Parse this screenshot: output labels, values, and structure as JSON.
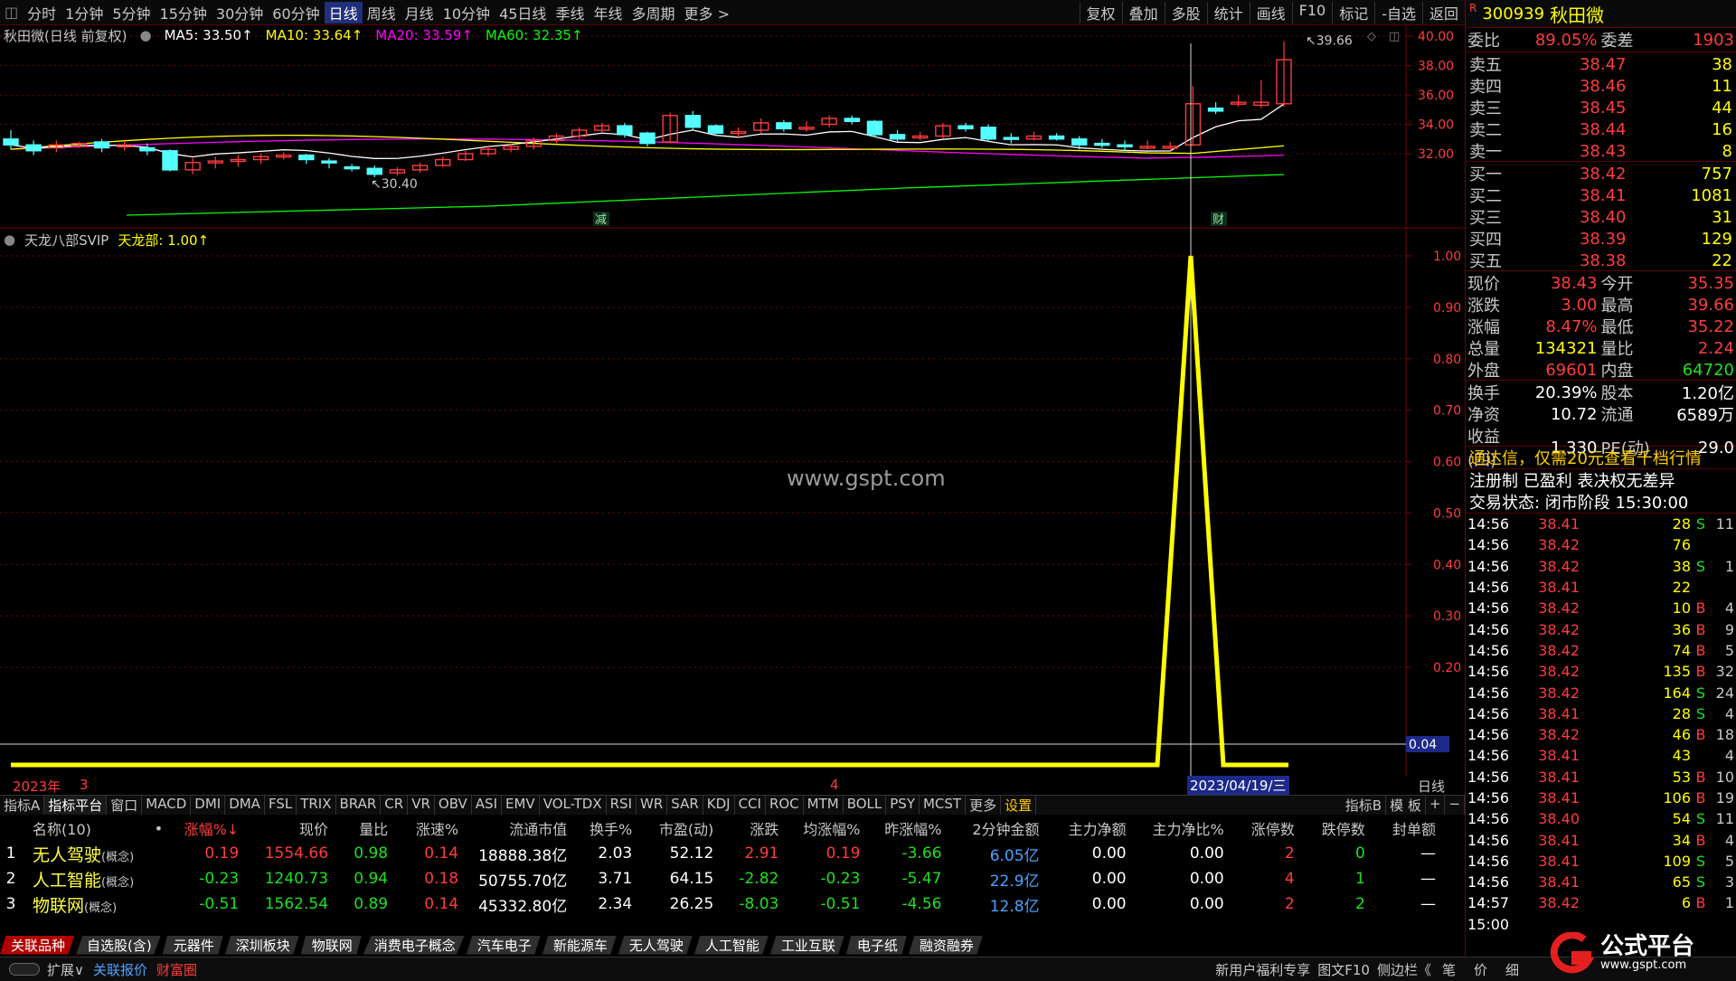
{
  "toolbar": {
    "periods": [
      "分时",
      "1分钟",
      "5分钟",
      "15分钟",
      "30分钟",
      "60分钟",
      "日线",
      "周线",
      "月线",
      "10分钟",
      "45日线",
      "季线",
      "年线",
      "多周期",
      "更多 >"
    ],
    "active_period": "日线",
    "tools": [
      "复权",
      "叠加",
      "多股",
      "统计",
      "画线",
      "F10",
      "标记",
      "-自选",
      "返回"
    ]
  },
  "chart": {
    "title": "秋田微(日线 前复权)",
    "ma5": "MA5: 33.50↑",
    "ma10": "MA10: 33.64↑",
    "ma20": "MA20: 33.59↑",
    "ma60": "MA60: 32.35↑",
    "high_label": "39.66",
    "low_label": "30.40",
    "marker_jian": "减",
    "marker_cai": "财",
    "price_axis": [
      "40.00",
      "38.00",
      "36.00",
      "34.00",
      "32.00"
    ],
    "indicator_title": "天龙八部SVIP",
    "indicator_value": "天龙部: 1.00↑",
    "indicator_axis": [
      "1.00",
      "0.90",
      "0.80",
      "0.70",
      "0.60",
      "0.50",
      "0.40",
      "0.30",
      "0.20"
    ],
    "indicator_cursor_value": "0.04",
    "date_year": "2023年",
    "date_m3": "3",
    "date_m4": "4",
    "cursor_date": "2023/04/19/三",
    "period_label": "日线",
    "watermark": "www.gspt.com"
  },
  "indicator_tabs": [
    "指标A",
    "指标平台",
    "窗口",
    "MACD",
    "DMI",
    "DMA",
    "FSL",
    "TRIX",
    "BRAR",
    "CR",
    "VR",
    "OBV",
    "ASI",
    "EMV",
    "VOL-TDX",
    "RSI",
    "WR",
    "SAR",
    "KDJ",
    "CCI",
    "ROC",
    "MTM",
    "BOLL",
    "PSY",
    "MCST",
    "更多",
    "设置"
  ],
  "indicator_tabs_right": [
    "指标B",
    "模 板",
    "+",
    "−"
  ],
  "sector_table": {
    "headers": [
      "名称(10)",
      "•",
      "涨幅%↓",
      "现价",
      "量比",
      "涨速%",
      "流通市值",
      "换手%",
      "市盈(动)",
      "涨跌",
      "均涨幅%",
      "昨涨幅%",
      "2分钟金额",
      "主力净额",
      "主力净比%",
      "涨停数",
      "跌停数",
      "封单额"
    ],
    "rows": [
      {
        "idx": "1",
        "name": "无人驾驶",
        "tag": "(概念)",
        "chg": "0.19",
        "price": "1554.66",
        "vr": "0.98",
        "spd": "0.14",
        "cap": "18888.38亿",
        "turn": "2.03",
        "pe": "52.12",
        "diff": "2.91",
        "avg": "0.19",
        "yday": "-3.66",
        "amt2": "6.05亿",
        "net": "0.00",
        "netp": "0.00",
        "up": "2",
        "down": "0",
        "seal": "—"
      },
      {
        "idx": "2",
        "name": "人工智能",
        "tag": "(概念)",
        "chg": "-0.23",
        "price": "1240.73",
        "vr": "0.94",
        "spd": "0.18",
        "cap": "50755.70亿",
        "turn": "3.71",
        "pe": "64.15",
        "diff": "-2.82",
        "avg": "-0.23",
        "yday": "-5.47",
        "amt2": "22.9亿",
        "net": "0.00",
        "netp": "0.00",
        "up": "4",
        "down": "1",
        "seal": "—"
      },
      {
        "idx": "3",
        "name": "物联网",
        "tag": "(概念)",
        "chg": "-0.51",
        "price": "1562.54",
        "vr": "0.89",
        "spd": "0.14",
        "cap": "45332.80亿",
        "turn": "2.34",
        "pe": "26.25",
        "diff": "-8.03",
        "avg": "-0.51",
        "yday": "-4.56",
        "amt2": "12.8亿",
        "net": "0.00",
        "netp": "0.00",
        "up": "2",
        "down": "2",
        "seal": "—"
      }
    ]
  },
  "bottom_tabs": [
    "关联品种",
    "自选股(含)",
    "元器件",
    "深圳板块",
    "物联网",
    "消费电子概念",
    "汽车电子",
    "新能源车",
    "无人驾驶",
    "人工智能",
    "工业互联",
    "电子纸",
    "融资融券"
  ],
  "status_bar": {
    "left": [
      "扩展∨",
      "关联报价",
      "财富圈"
    ],
    "right": [
      "新用户福利专享",
      "图文F10",
      "侧边栏《",
      "笔",
      "价",
      "细"
    ]
  },
  "quote": {
    "code": "300939",
    "name": "秋田微",
    "r_mark": "R",
    "weibi_label": "委比",
    "weibi": "89.05%",
    "weicha_label": "委差",
    "weicha": "1903",
    "asks": [
      [
        "卖五",
        "38.47",
        "38"
      ],
      [
        "卖四",
        "38.46",
        "11"
      ],
      [
        "卖三",
        "38.45",
        "44"
      ],
      [
        "卖二",
        "38.44",
        "16"
      ],
      [
        "卖一",
        "38.43",
        "8"
      ]
    ],
    "bids": [
      [
        "买一",
        "38.42",
        "757"
      ],
      [
        "买二",
        "38.41",
        "1081"
      ],
      [
        "买三",
        "38.40",
        "31"
      ],
      [
        "买四",
        "38.39",
        "129"
      ],
      [
        "买五",
        "38.38",
        "22"
      ]
    ],
    "stats1": [
      [
        "现价",
        "38.43",
        "今开",
        "35.35"
      ],
      [
        "涨跌",
        "3.00",
        "最高",
        "39.66"
      ],
      [
        "涨幅",
        "8.47%",
        "最低",
        "35.22"
      ],
      [
        "总量",
        "134321",
        "量比",
        "2.24"
      ],
      [
        "外盘",
        "69601",
        "内盘",
        "64720"
      ]
    ],
    "stats2": [
      [
        "换手",
        "20.39%",
        "股本",
        "1.20亿"
      ],
      [
        "净资",
        "10.72",
        "流通",
        "6589万"
      ],
      [
        "收益(四)",
        "1.330",
        "PE(动)",
        "29.0"
      ]
    ],
    "promo": "通达信，仅需20元查看千档行情",
    "regline": "注册制 已盈利 表决权无差异",
    "trade_state": "交易状态: 闭市阶段 15:30:00",
    "ticks": [
      [
        "14:56",
        "38.41",
        "28",
        "S",
        "11"
      ],
      [
        "14:56",
        "38.42",
        "76",
        "",
        ""
      ],
      [
        "14:56",
        "38.42",
        "38",
        "S",
        "1"
      ],
      [
        "14:56",
        "38.41",
        "22",
        "",
        ""
      ],
      [
        "14:56",
        "38.42",
        "10",
        "B",
        "4"
      ],
      [
        "14:56",
        "38.42",
        "36",
        "B",
        "9"
      ],
      [
        "14:56",
        "38.42",
        "74",
        "B",
        "5"
      ],
      [
        "14:56",
        "38.42",
        "135",
        "B",
        "32"
      ],
      [
        "14:56",
        "38.42",
        "164",
        "S",
        "24"
      ],
      [
        "14:56",
        "38.41",
        "28",
        "S",
        "4"
      ],
      [
        "14:56",
        "38.42",
        "46",
        "B",
        "18"
      ],
      [
        "14:56",
        "38.41",
        "43",
        "",
        "4"
      ],
      [
        "14:56",
        "38.41",
        "53",
        "B",
        "10"
      ],
      [
        "14:56",
        "38.41",
        "106",
        "B",
        "19"
      ],
      [
        "14:56",
        "38.40",
        "54",
        "S",
        "11"
      ],
      [
        "14:56",
        "38.41",
        "34",
        "B",
        "4"
      ],
      [
        "14:56",
        "38.41",
        "109",
        "S",
        "5"
      ],
      [
        "14:56",
        "38.41",
        "65",
        "S",
        "3"
      ],
      [
        "14:57",
        "38.42",
        "6",
        "B",
        "1"
      ],
      [
        "15:00",
        "",
        "",
        "",
        ""
      ]
    ]
  },
  "logo": {
    "text": "公式平台",
    "url": "www.gspt.com"
  },
  "colors": {
    "up": "#ff3c3c",
    "down": "#1ee11e",
    "candle_down": "#54ffff",
    "ma5": "#ffffff",
    "ma10": "#ffff00",
    "ma20": "#ff00ff",
    "ma60": "#00ff00",
    "indicator": "#ffff00",
    "grid": "#7a0000"
  }
}
